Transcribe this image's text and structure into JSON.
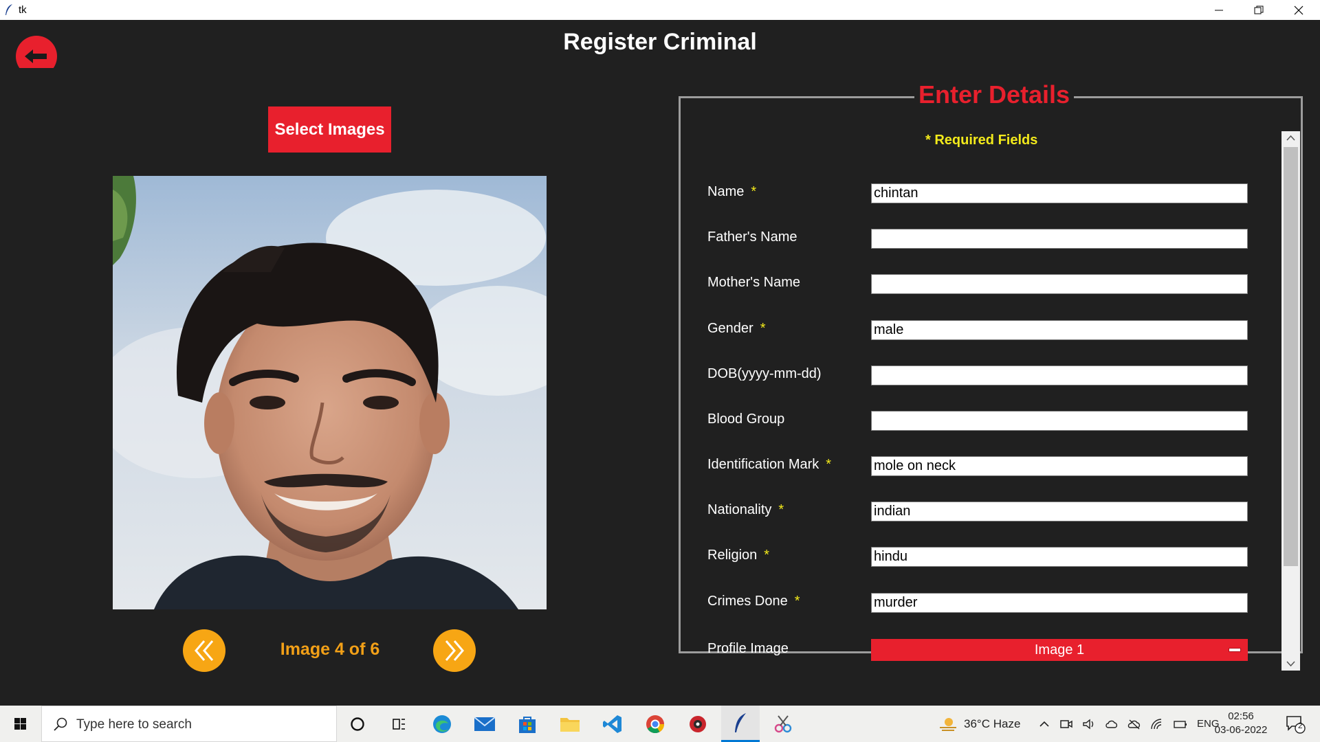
{
  "window": {
    "title": "tk"
  },
  "app": {
    "page_title": "Register Criminal",
    "select_images_label": "Select Images",
    "image_counter": "Image 4 of 6"
  },
  "details": {
    "legend": "Enter Details",
    "required_note": "* Required Fields",
    "fields": [
      {
        "label": "Name",
        "required": "*",
        "value": "chintan"
      },
      {
        "label": "Father's Name",
        "required": "",
        "value": ""
      },
      {
        "label": "Mother's Name",
        "required": "",
        "value": ""
      },
      {
        "label": "Gender",
        "required": "*",
        "value": "male"
      },
      {
        "label": "DOB(yyyy-mm-dd)",
        "required": "",
        "value": ""
      },
      {
        "label": "Blood Group",
        "required": "",
        "value": ""
      },
      {
        "label": "Identification Mark",
        "required": "*",
        "value": "mole on neck"
      },
      {
        "label": "Nationality",
        "required": "*",
        "value": "indian"
      },
      {
        "label": "Religion",
        "required": "*",
        "value": "hindu"
      },
      {
        "label": "Crimes Done",
        "required": "*",
        "value": "murder"
      }
    ],
    "profile_image": {
      "label": "Profile Image",
      "value": "Image 1"
    }
  },
  "taskbar": {
    "search_placeholder": "Type here to search",
    "weather": "36°C  Haze",
    "language": "ENG",
    "time": "02:56",
    "date": "03-06-2022",
    "notification_count": "2"
  },
  "colors": {
    "background": "#202020",
    "accent_red": "#e8202d",
    "required_yellow": "#f3ea1b",
    "nav_orange": "#f7a614"
  }
}
